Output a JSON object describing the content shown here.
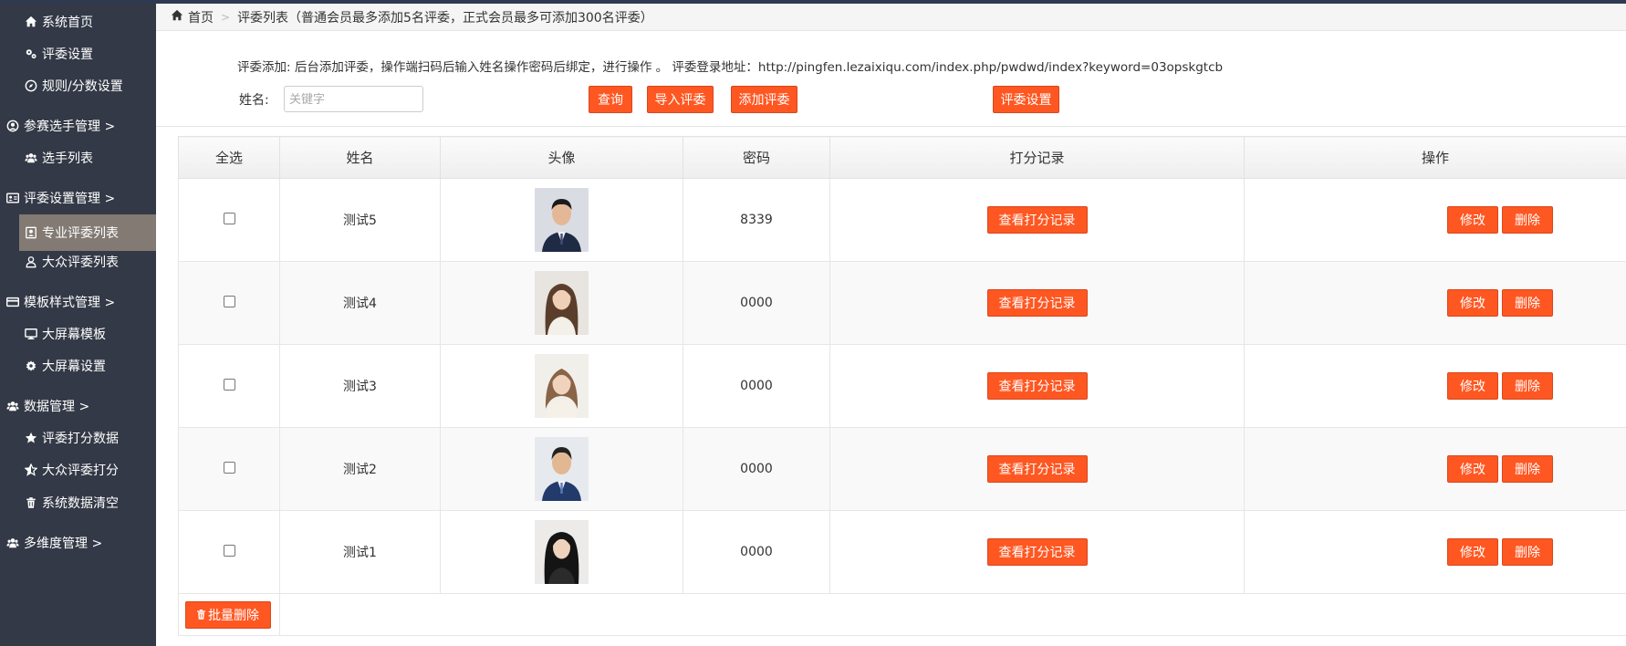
{
  "sidebar": {
    "items": [
      {
        "label": "系统首页",
        "icon": "home-icon"
      },
      {
        "label": "评委设置",
        "icon": "gears-icon"
      },
      {
        "label": "规则/分数设置",
        "icon": "compass-icon"
      },
      {
        "label": "参赛选手管理 >",
        "icon": "user-circle-icon"
      },
      {
        "label": "选手列表",
        "icon": "users-icon"
      },
      {
        "label": "评委设置管理 >",
        "icon": "id-card-icon"
      },
      {
        "label": "专业评委列表",
        "icon": "portrait-icon"
      },
      {
        "label": "大众评委列表",
        "icon": "user-icon"
      },
      {
        "label": "模板样式管理 >",
        "icon": "credit-card-icon"
      },
      {
        "label": "大屏幕模板",
        "icon": "desktop-icon"
      },
      {
        "label": "大屏幕设置",
        "icon": "gear-icon"
      },
      {
        "label": "数据管理 >",
        "icon": "users-icon"
      },
      {
        "label": "评委打分数据",
        "icon": "star-icon"
      },
      {
        "label": "大众评委打分",
        "icon": "star-half-icon"
      },
      {
        "label": "系统数据清空",
        "icon": "trash-icon"
      },
      {
        "label": "多维度管理 >",
        "icon": "users-icon"
      }
    ],
    "active": "专业评委列表"
  },
  "breadcrumb": {
    "home": "首页",
    "current": "评委列表（普通会员最多添加5名评委，正式会员最多可添加300名评委）"
  },
  "notice": "评委添加: 后台添加评委，操作端扫码后输入姓名操作密码后绑定，进行操作 。 评委登录地址：http://pingfen.lezaixiqu.com/index.php/pwdwd/index?keyword=03opskgtcb",
  "search": {
    "label": "姓名:",
    "placeholder": "关键字",
    "value": "",
    "query_btn": "查询",
    "import_btn": "导入评委",
    "add_btn": "添加评委",
    "settings_btn": "评委设置"
  },
  "table": {
    "headers": [
      "全选",
      "姓名",
      "头像",
      "密码",
      "打分记录",
      "操作"
    ],
    "rows": [
      {
        "name": "测试5",
        "password": "8339",
        "avatar": "male-suit-avatar"
      },
      {
        "name": "测试4",
        "password": "0000",
        "avatar": "female-long-hair-avatar"
      },
      {
        "name": "测试3",
        "password": "0000",
        "avatar": "female-short-hair-avatar"
      },
      {
        "name": "测试2",
        "password": "0000",
        "avatar": "male-blue-suit-avatar"
      },
      {
        "name": "测试1",
        "password": "0000",
        "avatar": "female-dark-hair-avatar"
      }
    ],
    "record_btn": "查看打分记录",
    "edit_btn": "修改",
    "delete_btn": "删除",
    "bulk_delete": "批量删除"
  },
  "colors": {
    "accent": "#ff5722",
    "sidebar_bg": "#333946",
    "sidebar_active": "#837a73"
  }
}
